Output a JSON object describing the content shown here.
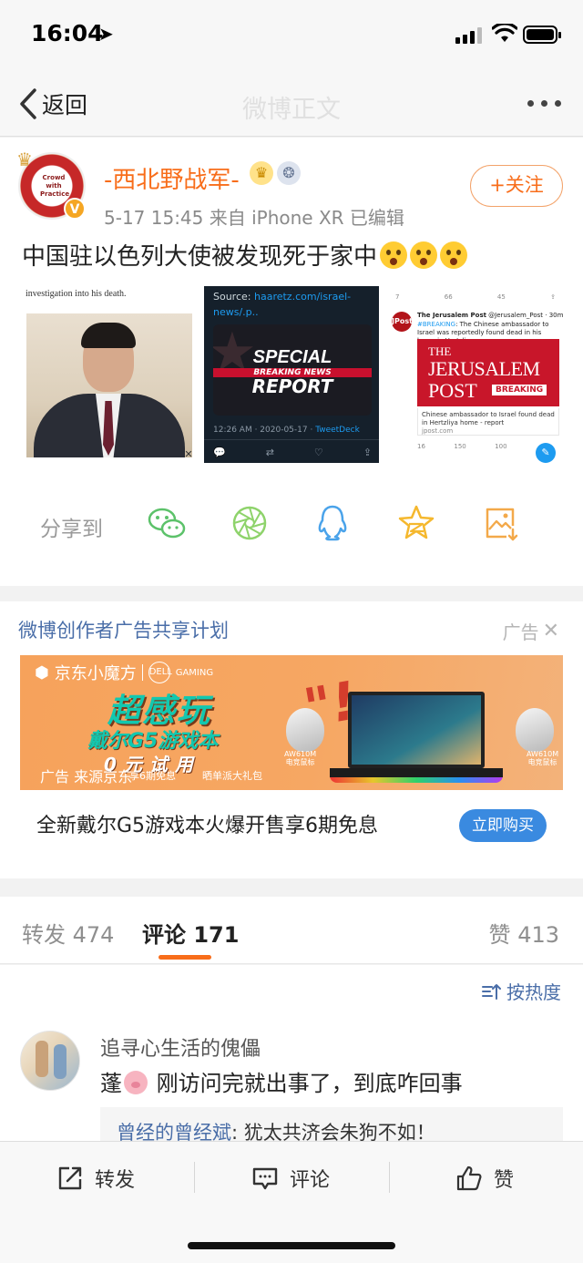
{
  "status_bar": {
    "time": "16:04"
  },
  "nav": {
    "back_label": "返回",
    "title": "微博正文"
  },
  "post": {
    "username": "-西北野战军-",
    "meta": "5-17 15:45  来自 iPhone XR  已编辑",
    "follow_label": "+关注",
    "text": "中国驻以色列大使被发现死于家中",
    "avatar_badge": "V",
    "avatar_text": "Crowd with Practice",
    "images": [
      {
        "caption": "investigation into his death."
      },
      {
        "source_prefix": "Source: ",
        "source_link": "haaretz.com/israel-news/.p..",
        "line1": "SPECIAL",
        "strip": "BREAKING NEWS",
        "line2": "REPORT",
        "time": "12:26 AM · 2020-05-17 · ",
        "client": "TweetDeck"
      },
      {
        "handle": "The Jerusalem Post",
        "handle_meta": " @Jerusalem_Post · 30m",
        "hashtag": "#BREAKING",
        "tweet": ": The Chinese ambassador to Israel was reportedly found dead in his home in Hertzliya.",
        "logo": "JPost",
        "brand_the": "THE",
        "brand_jerusalem": "JERUSALEM",
        "brand_post": "POST",
        "brand_breaking": "BREAKING",
        "card_title": "Chinese ambassador to Israel found dead in Hertzliya home - report",
        "card_domain": "jpost.com",
        "stats": [
          "16",
          "150",
          "100"
        ],
        "top_stats": [
          "7",
          "66",
          "45"
        ]
      }
    ]
  },
  "share": {
    "label": "分享到",
    "icons": [
      "wechat-icon",
      "moments-icon",
      "qq-icon",
      "qzone-icon",
      "save-image-icon"
    ],
    "colors": {
      "wechat": "#5cc26a",
      "moments": "#8ed36b",
      "qq": "#4aa3ea",
      "qzone": "#f5b82e",
      "save": "#f3a94a"
    }
  },
  "ad": {
    "program": "微博创作者广告共享计划",
    "label": "广告",
    "brand": "京东小魔方",
    "dell": "DELL",
    "gaming": "GAMING",
    "slogan1": "超感玩",
    "slogan2": "戴尔G5游戏本",
    "slogan3": "0元试用",
    "note1": "享6期免息",
    "note2": "晒单派大礼包",
    "source": "广告 来源京东",
    "mouse1": "AW610M\n电竞鼠标",
    "mouse2": "AW610M\n电竞鼠标",
    "caption": "全新戴尔G5游戏本火爆开售享6期免息",
    "cta": "立即购买"
  },
  "tabs": [
    {
      "label": "转发",
      "count": "474"
    },
    {
      "label": "评论",
      "count": "171"
    },
    {
      "label": "赞",
      "count": "413"
    }
  ],
  "comments": {
    "sort_label": "按热度",
    "items": [
      {
        "user": "追寻心生活的傀儡",
        "text_before": "蓬",
        "text_after": " 刚访问完就出事了，到底咋回事",
        "reply_user": "曾经的曾经斌",
        "reply_text": ": 犹太共济会朱狗不如！"
      }
    ]
  },
  "bottom_bar": {
    "repost": "转发",
    "comment": "评论",
    "like": "赞"
  }
}
